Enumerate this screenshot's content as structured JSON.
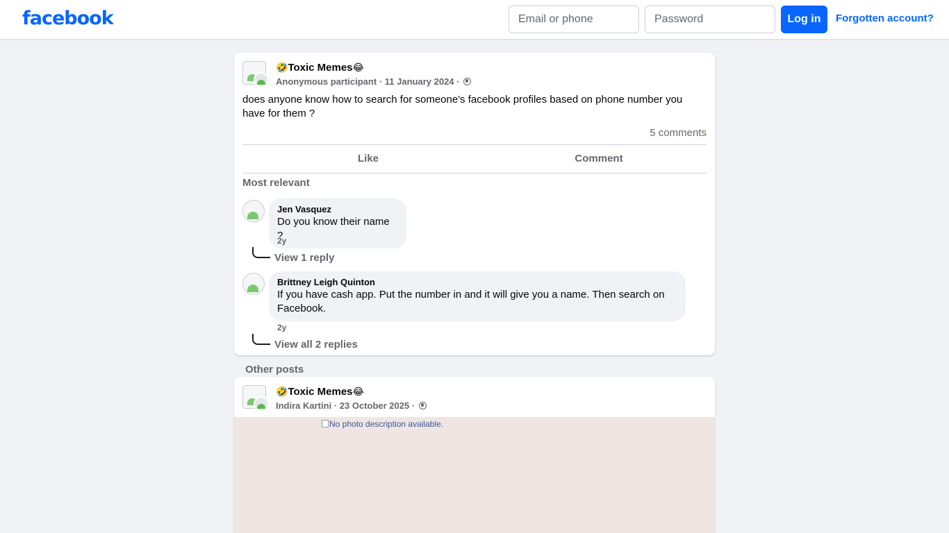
{
  "header": {
    "logo": "facebook",
    "email_placeholder": "Email or phone",
    "password_placeholder": "Password",
    "login_label": "Log in",
    "forgot_label": "Forgotten account?"
  },
  "post": {
    "group_name": "Toxic Memes",
    "emoji_left": "🤣",
    "emoji_right": "😂",
    "author": "Anonymous participant",
    "date": "11 January 2024",
    "separator": "·",
    "text": "does anyone know how to search for someone's facebook profiles based on phone number you have for them ?",
    "comments_count": "5 comments",
    "like_label": "Like",
    "comment_label": "Comment",
    "sort_label": "Most relevant",
    "comments": [
      {
        "author": "Jen Vasquez",
        "text": "Do you know their name ?",
        "time": "2y",
        "replies_label": "View 1 reply"
      },
      {
        "author": "Brittney Leigh Quinton",
        "text": "If you have cash app. Put the number in and it will give you a name. Then search on Facebook.",
        "time": "2y",
        "replies_label": "View all 2 replies"
      }
    ]
  },
  "other_posts": {
    "label": "Other posts",
    "post": {
      "group_name": "Toxic Memes",
      "emoji_left": "🤣",
      "emoji_right": "😂",
      "author": "Indira Kartini",
      "date": "23 October 2025",
      "separator": "·",
      "image_alt": "No photo description available."
    }
  },
  "colors": {
    "brand": "#0866ff",
    "background": "#f0f2f5",
    "secondary_text": "#65676b"
  }
}
